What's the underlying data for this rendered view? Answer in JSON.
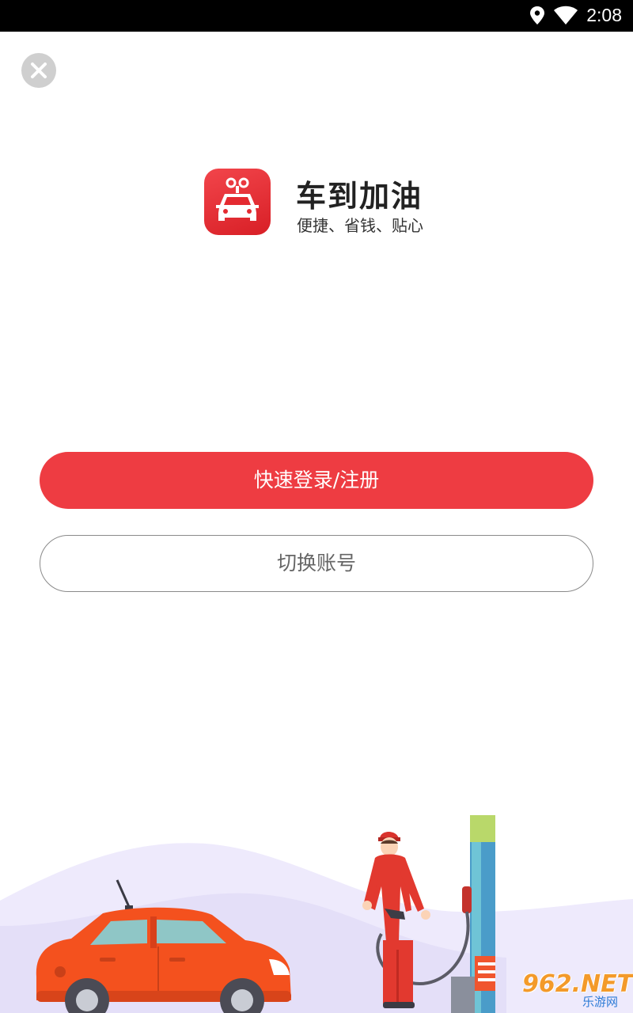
{
  "status_bar": {
    "time": "2:08",
    "icons": [
      "location-icon",
      "wifi-icon"
    ]
  },
  "close": {
    "icon": "close-icon"
  },
  "brand": {
    "app_name": "车到加油",
    "slogan": "便捷、省钱、贴心"
  },
  "actions": {
    "primary_label": "快速登录/注册",
    "secondary_label": "切换账号"
  },
  "watermark": {
    "main": "962.NET",
    "sub": "乐游网"
  },
  "colors": {
    "accent": "#ee3c42",
    "status_bar": "#000000",
    "background": "#ffffff",
    "car": "#f4511e",
    "pump": "#4a9cc9"
  }
}
